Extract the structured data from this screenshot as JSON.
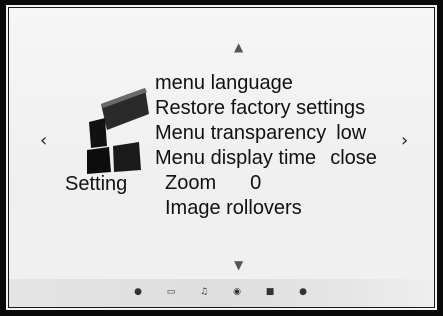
{
  "setting": {
    "label": "Setting",
    "icon": "setting-blocks-icon"
  },
  "menu": {
    "items": [
      {
        "label": "menu language",
        "value": ""
      },
      {
        "label": "Restore factory settings",
        "value": ""
      },
      {
        "label": "Menu transparency",
        "value": "low"
      },
      {
        "label": "Menu display time",
        "value": "close"
      },
      {
        "label": "Zoom",
        "value": "0"
      },
      {
        "label": "Image rollovers",
        "value": ""
      }
    ]
  },
  "nav": {
    "up_icon": "triangle-up-icon",
    "down_icon": "triangle-down-icon",
    "left_icon": "chevron-left-icon",
    "right_icon": "chevron-right-icon"
  },
  "bottom_bar": {
    "icons": [
      "picture-icon",
      "tv-icon",
      "music-icon",
      "clock-icon",
      "lock-icon",
      "setting-icon"
    ]
  },
  "colors": {
    "frame": "#0a0a0a",
    "background": "#f3f3f3",
    "text": "#111111",
    "bar": "#e0e0e0"
  }
}
